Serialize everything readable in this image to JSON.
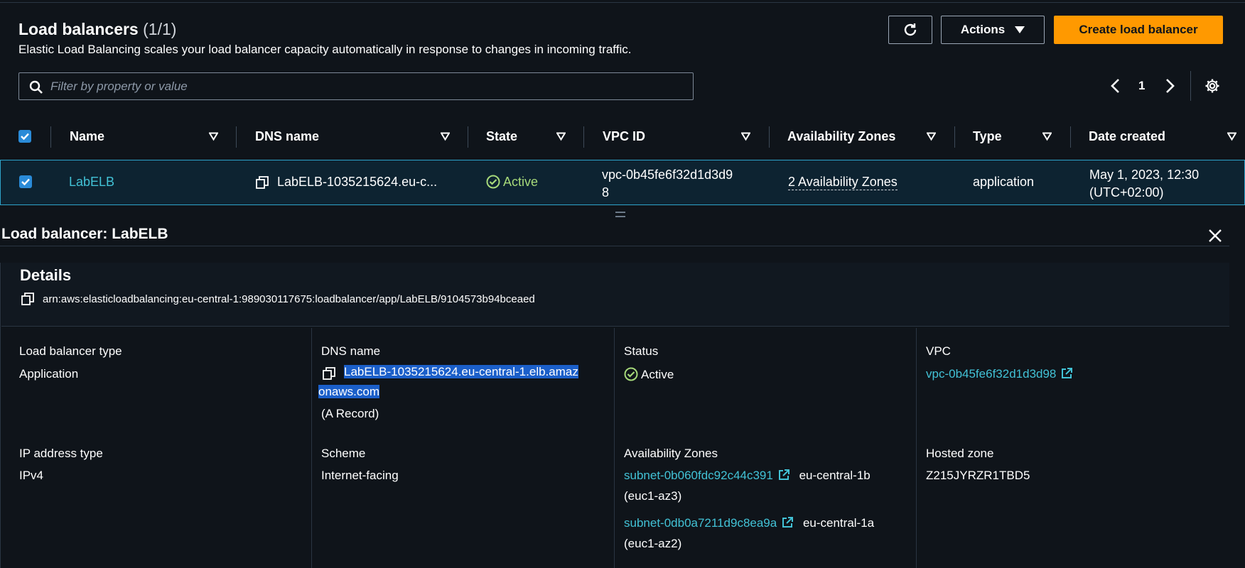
{
  "header": {
    "title": "Load balancers",
    "count": "(1/1)",
    "subtitle": "Elastic Load Balancing scales your load balancer capacity automatically in response to changes in incoming traffic.",
    "actions_label": "Actions",
    "create_label": "Create load balancer"
  },
  "filter": {
    "placeholder": "Filter by property or value"
  },
  "pagination": {
    "page": "1"
  },
  "table": {
    "columns": [
      "Name",
      "DNS name",
      "State",
      "VPC ID",
      "Availability Zones",
      "Type",
      "Date created"
    ],
    "row": {
      "name": "LabELB",
      "dns": "LabELB-1035215624.eu-c...",
      "state": "Active",
      "vpc_line1": "vpc-0b45fe6f32d1d3d9",
      "vpc_line2": "8",
      "azs": "2 Availability Zones",
      "type": "application",
      "date_line1": "May 1, 2023, 12:30",
      "date_line2": "(UTC+02:00)"
    }
  },
  "panel": {
    "title": "Load balancer: LabELB",
    "details_title": "Details",
    "arn": "arn:aws:elasticloadbalancing:eu-central-1:989030117675:loadbalancer/app/LabELB/9104573b94bceaed",
    "lb_type_label": "Load balancer type",
    "lb_type_value": "Application",
    "dns_label": "DNS name",
    "dns_line1": "LabELB-1035215624.eu-central-1.elb.amaz",
    "dns_line2": "onaws.com",
    "dns_record": "(A Record)",
    "status_label": "Status",
    "status_value": "Active",
    "vpc_label": "VPC",
    "vpc_value": "vpc-0b45fe6f32d1d3d98",
    "ip_label": "IP address type",
    "ip_value": "IPv4",
    "scheme_label": "Scheme",
    "scheme_value": "Internet-facing",
    "az_label": "Availability Zones",
    "subnet1": "subnet-0b060fdc92c44c391",
    "subnet1_zone": "eu-central-1b",
    "subnet1_az": "(euc1-az3)",
    "subnet2": "subnet-0db0a7211d9c8ea9a",
    "subnet2_zone": "eu-central-1a",
    "subnet2_az": "(euc1-az2)",
    "hz_label": "Hosted zone",
    "hz_value": "Z215JYRZR1TBD5"
  },
  "colors": {
    "accent": "#ff9900",
    "link": "#42c2d6",
    "success": "#a6d97a",
    "selection": "#1b5fc9"
  }
}
